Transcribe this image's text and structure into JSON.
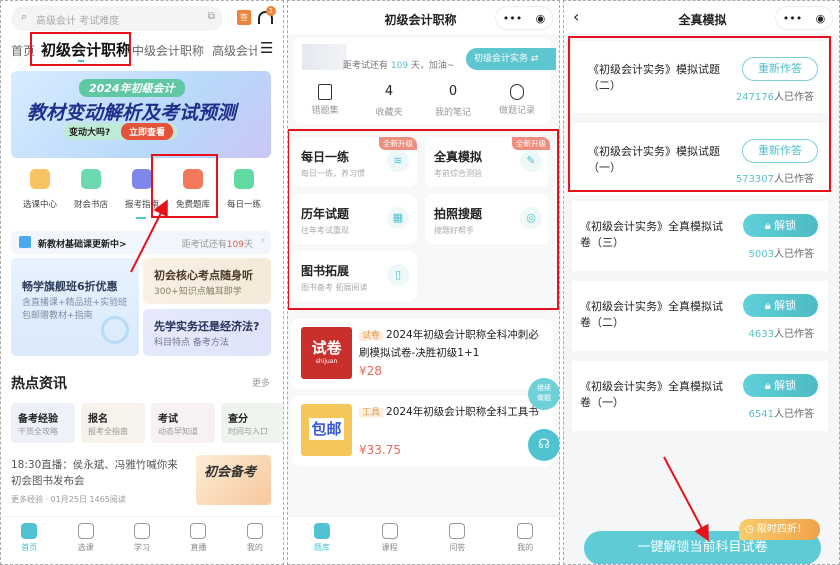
{
  "left": {
    "search_placeholder": "高级会计 考试难度",
    "sign_icon_text": "签",
    "headset_badge": "1",
    "tabs": [
      "首页",
      "初级会计职称",
      "中级会计职称",
      "高级会计"
    ],
    "banner": {
      "tag": "2024年初级会计",
      "title": "教材变动解析及考试预测",
      "pill": "变动大吗?",
      "cta": "立即查看"
    },
    "icons": [
      {
        "label": "选课中心",
        "color": "#f7b844"
      },
      {
        "label": "财会书店",
        "color": "#52d3a0"
      },
      {
        "label": "报考指南",
        "color": "#6a72e8"
      },
      {
        "label": "免费题库",
        "color": "#f0613f"
      },
      {
        "label": "每日一练",
        "color": "#45d392"
      }
    ],
    "notice": {
      "text": "新教材基础课更新中>",
      "countdown_prefix": "距考试还有",
      "days": "109",
      "suffix": "天"
    },
    "promo": [
      {
        "title": "畅学旗舰班6折优惠",
        "sub1": "含直播课+精品班+实验班",
        "sub2": "包邮赠教材+指南"
      },
      {
        "title": "初会核心考点随身听",
        "sub1": "300+知识点触耳即学"
      },
      {
        "title": "先学实务还是经济法?",
        "sub1": "科目特点 备考方法"
      }
    ],
    "hot": {
      "title": "热点资讯",
      "more": "更多"
    },
    "categories": [
      {
        "t": "备考经验",
        "s": "干货全攻略"
      },
      {
        "t": "报名",
        "s": "报考全指南"
      },
      {
        "t": "考试",
        "s": "动态早知道"
      },
      {
        "t": "查分",
        "s": "时间与入口"
      }
    ],
    "news": {
      "title": "18:30直播：侯永斌、冯雅竹喊你来初会图书发布会",
      "meta": "更多经验 · 01月25日   1465阅读",
      "image_text": "初会备考"
    },
    "nav": [
      "首页",
      "选课",
      "学习",
      "直播",
      "我的"
    ]
  },
  "middle": {
    "title": "初级会计职称",
    "countdown": {
      "prefix": "距考试还有 ",
      "days": "109",
      "suffix": " 天，加油~"
    },
    "subject": "初级会计实务 ⇄",
    "stats": [
      {
        "value": "",
        "label": "错题集"
      },
      {
        "value": "4",
        "label": "收藏夹"
      },
      {
        "value": "0",
        "label": "我的笔记"
      },
      {
        "value": "",
        "label": "做题记录"
      }
    ],
    "grid": [
      {
        "t": "每日一练",
        "s": "每日一练，养习惯",
        "badge": "全新升级"
      },
      {
        "t": "全真模拟",
        "s": "考前综合测验",
        "badge": "全新升级"
      },
      {
        "t": "历年试题",
        "s": "往年考试重现"
      },
      {
        "t": "拍照搜题",
        "s": "搜题好帮手"
      },
      {
        "t": "图书拓展",
        "s": "图书备考 拓展阅读"
      }
    ],
    "products": [
      {
        "tag": "试卷",
        "title": "2024年初级会计职称全科冲刺必刷模拟试卷-决胜初级1+1",
        "price": "¥28",
        "img": "试卷",
        "img_sub": "shijuan"
      },
      {
        "tag": "工具",
        "title": "2024年初级会计职称全科工具书",
        "price": "¥33.75",
        "img": "包邮"
      }
    ],
    "float_continue": "继续做题",
    "nav": [
      "题库",
      "课程",
      "问答",
      "我的"
    ]
  },
  "right": {
    "title": "全真模拟",
    "items": [
      {
        "title": "《初级会计实务》模拟试题（二）",
        "button": "重新作答",
        "count": "247176",
        "count_suffix": "人已作答"
      },
      {
        "title": "《初级会计实务》模拟试题（一）",
        "button": "重新作答",
        "count": "573307",
        "count_suffix": "人已作答"
      },
      {
        "title": "《初级会计实务》全真模拟试卷（三）",
        "button": "解锁",
        "count": "5003",
        "count_suffix": "人已作答"
      },
      {
        "title": "《初级会计实务》全真模拟试卷（二）",
        "button": "解锁",
        "count": "4633",
        "count_suffix": "人已作答"
      },
      {
        "title": "《初级会计实务》全真模拟试卷（一）",
        "button": "解锁",
        "count": "6541",
        "count_suffix": "人已作答"
      }
    ],
    "unlock_all": "一键解锁当前科目试卷",
    "promo_badge": "限时四折！"
  },
  "colors": {
    "accent": "#4fc3cf",
    "highlight": "#e4131b",
    "price": "#e86a5a"
  }
}
